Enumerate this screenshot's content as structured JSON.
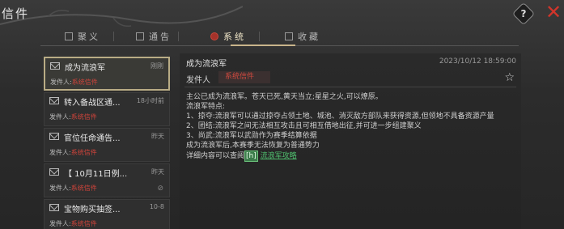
{
  "window": {
    "title": "信件"
  },
  "header": {
    "help_glyph": "?",
    "close_glyph": "✕"
  },
  "tabs": [
    {
      "label": "聚义",
      "active": false
    },
    {
      "label": "通告",
      "active": false
    },
    {
      "label": "系统",
      "active": true
    },
    {
      "label": "收藏",
      "active": false
    }
  ],
  "mail_list": [
    {
      "subject": "成为流浪军",
      "time": "刚刚",
      "sender_label": "发件人:",
      "sender": "系统信件",
      "selected": true,
      "attachment": false
    },
    {
      "subject": "转入备战区通...",
      "time": "18小时前",
      "sender_label": "发件人:",
      "sender": "系统信件",
      "selected": false,
      "attachment": false
    },
    {
      "subject": "官位任命通告...",
      "time": "昨天",
      "sender_label": "发件人:",
      "sender": "系统信件",
      "selected": false,
      "attachment": false
    },
    {
      "subject": "【 10月11日例...",
      "time": "昨天",
      "sender_label": "发件人:",
      "sender": "系统信件",
      "selected": false,
      "attachment": true
    },
    {
      "subject": "宝物购买抽签...",
      "time": "10-8",
      "sender_label": "发件人:",
      "sender": "系统信件",
      "selected": false,
      "attachment": false
    }
  ],
  "mail": {
    "title": "成为流浪军",
    "date": "2023/10/12 18:59:00",
    "sender_label": "发件人",
    "sender": "系统信件",
    "body_lines": [
      "主公已成为流浪军。苍天已死,黄天当立;星星之火,可以燎原。",
      "流浪军特点:",
      "1、掠夺:流浪军可以通过掠夺占领土地、城池、消灭敌方部队来获得资源,但领地不具备资源产量",
      "2、团结:流浪军之间无法相互攻击且可相互借地出征,并可进一步组建聚义",
      "3、尚武:流浪军以武勋作为赛季结算依据",
      "成为流浪军后,本赛季无法恢复为普通势力"
    ],
    "detail_prefix": "详细内容可以查阅",
    "detail_badge": "[h]",
    "detail_link": "流浪军攻略"
  },
  "colors": {
    "accent_red": "#d0443b",
    "link_green": "#4fbf6e",
    "selected_border": "#b9ac85"
  }
}
